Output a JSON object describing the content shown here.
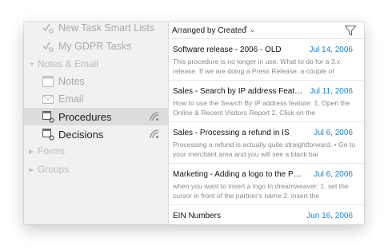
{
  "sidebar": {
    "items": [
      {
        "label": "New Task Smart Lists",
        "icon": "smart-list-icon"
      },
      {
        "label": "My GDPR Tasks",
        "icon": "smart-list-icon"
      },
      {
        "label": "Notes & Email",
        "icon": "disclosure-expanded-icon"
      },
      {
        "label": "Notes",
        "icon": "note-icon"
      },
      {
        "label": "Email",
        "icon": "email-icon"
      },
      {
        "label": "Procedures",
        "icon": "procedure-icon",
        "selected": true
      },
      {
        "label": "Decisions",
        "icon": "procedure-icon"
      },
      {
        "label": "Forms",
        "icon": "disclosure-collapsed-icon"
      },
      {
        "label": "Groups",
        "icon": "disclosure-collapsed-icon"
      }
    ]
  },
  "list": {
    "sort_label": "Arranged by Created",
    "sort_chevron": "⌃⌄",
    "filter_icon": "filter-icon",
    "tasks": [
      {
        "title": "Software release - 2006 - OLD",
        "date": "Jul 14, 2006",
        "preview": "This procedure is no longer in use. What to do for a 3.x release. If we are doing a Press Release. a couple of"
      },
      {
        "title": "Sales - Search by IP address Featur...",
        "date": "Jul 11, 2006",
        "preview": "How to use the Search By IP address feature: 1. Open the Online & Recent Visitors Report 2. Click on the"
      },
      {
        "title": "Sales - Processing a refund in IS",
        "date": "Jul 6, 2006",
        "preview": "Processing a refund is actually quite straightforward. • Go to your merchant area and you will see a black bar"
      },
      {
        "title": "Marketing - Adding a logo to the Par...",
        "date": "Jul 6, 2006",
        "preview": "when you want to insert a logo in dreamweaver: 1. set the cursor in front of the partner's name 2. insert the"
      },
      {
        "title": "EIN Numbers",
        "date": "Jun 16, 2006",
        "preview": ""
      }
    ]
  },
  "colors": {
    "accent_date": "#1a84d6",
    "selection": "#dcdcdc",
    "sidebar_bg": "#f1f1f1"
  }
}
